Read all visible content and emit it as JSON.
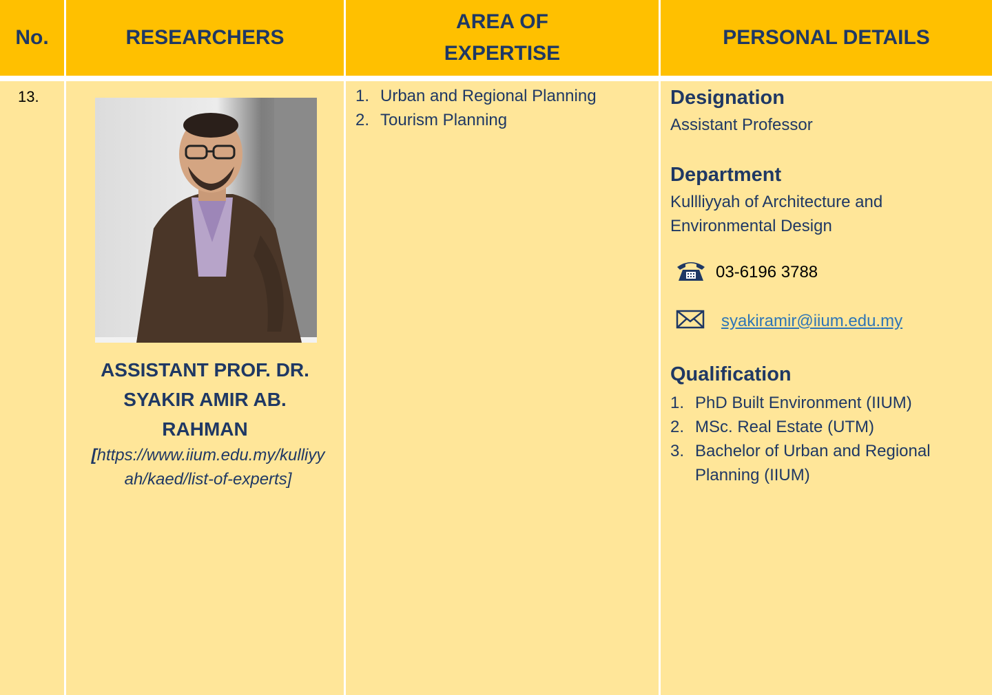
{
  "header": {
    "no": "No.",
    "researchers": "RESEARCHERS",
    "area_line1": "AREA OF",
    "area_line2": "EXPERTISE",
    "personal": "PERSONAL DETAILS"
  },
  "row": {
    "number": "13.",
    "name_line1": "ASSISTANT PROF. DR.",
    "name_line2": "SYAKIR AMIR AB.",
    "name_line3": "RAHMAN",
    "source_open": "[",
    "source_url": "https://www.iium.edu.my/kulliyyah/kaed/list-of-experts]",
    "expertise": [
      {
        "n": "1.",
        "text": "Urban and Regional Planning"
      },
      {
        "n": "2.",
        "text": "Tourism Planning"
      }
    ],
    "designation_label": "Designation",
    "designation_value": "Assistant Professor",
    "department_label": "Department",
    "department_line1": "Kullliyyah of Architecture and",
    "department_line2": "Environmental Design",
    "phone": "03-6196 3788",
    "email": "syakiramir@iium.edu.my",
    "qualification_label": "Qualification",
    "qualifications": [
      {
        "n": "1.",
        "text": "PhD Built Environment (IIUM)"
      },
      {
        "n": "2.",
        "text": "MSc. Real Estate (UTM)"
      },
      {
        "n": "3.",
        "text": "Bachelor of Urban and Regional Planning (IIUM)"
      }
    ],
    "icons": [
      "phone-icon",
      "envelope-icon"
    ]
  },
  "colors": {
    "header_bg": "#FFC000",
    "cell_bg": "#FFE699",
    "text_navy": "#1F3864",
    "link": "#2E75B6"
  }
}
